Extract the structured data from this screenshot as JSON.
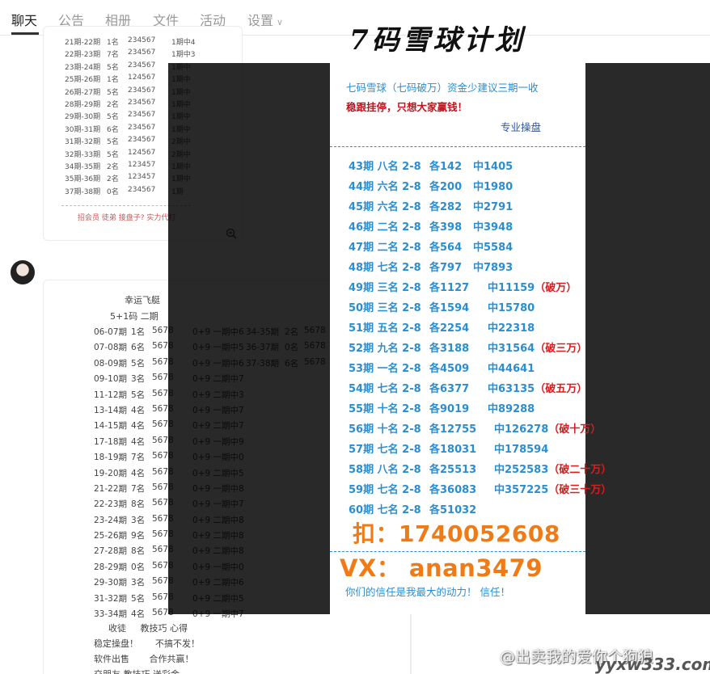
{
  "tabs": [
    "聊天",
    "公告",
    "相册",
    "文件",
    "活动",
    "设置"
  ],
  "card1": {
    "rows": [
      [
        "21期-22期",
        "1名",
        "234567",
        "1期中4"
      ],
      [
        "22期-23期",
        "7名",
        "234567",
        "1期中3"
      ],
      [
        "23期-24期",
        "5名",
        "234567",
        "1期中"
      ],
      [
        "25期-26期",
        "1名",
        "124567",
        "1期中"
      ],
      [
        "26期-27期",
        "5名",
        "234567",
        "1期中"
      ],
      [
        "28期-29期",
        "2名",
        "234567",
        "1期中"
      ],
      [
        "29期-30期",
        "5名",
        "234567",
        "1期中"
      ],
      [
        "30期-31期",
        "6名",
        "234567",
        "1期中"
      ],
      [
        "31期-32期",
        "5名",
        "234567",
        "2期中"
      ],
      [
        "32期-33期",
        "5名",
        "124567",
        "2期中"
      ],
      [
        "34期-35期",
        "2名",
        "123457",
        "1期中"
      ],
      [
        "35期-36期",
        "2名",
        "123457",
        "1期中"
      ],
      [
        "37期-38期",
        "0名",
        "234567",
        "1期"
      ]
    ],
    "footer": "招会员 徒弟 接盘子? 实力代打"
  },
  "card2": {
    "title": "幸运飞艇",
    "subtitle": "5+1码 二期",
    "rows": [
      [
        "06-07期",
        "1名",
        "5678",
        "0+9 一期中6"
      ],
      [
        "07-08期",
        "6名",
        "5678",
        "0+9 一期中5"
      ],
      [
        "08-09期",
        "5名",
        "5678",
        "0+9 一期中6"
      ],
      [
        "09-10期",
        "3名",
        "5678",
        "0+9 二期中7"
      ],
      [
        "11-12期",
        "5名",
        "5678",
        "0+9 二期中3"
      ],
      [
        "13-14期",
        "4名",
        "5678",
        "0+9 一期中7"
      ],
      [
        "14-15期",
        "4名",
        "5678",
        "0+9 二期中7"
      ],
      [
        "17-18期",
        "4名",
        "5678",
        "0+9 一期中9"
      ],
      [
        "18-19期",
        "7名",
        "5678",
        "0+9 一期中0"
      ],
      [
        "19-20期",
        "4名",
        "5678",
        "0+9 二期中5"
      ],
      [
        "21-22期",
        "7名",
        "5678",
        "0+9 一期中8"
      ],
      [
        "22-23期",
        "8名",
        "5678",
        "0+9 一期中7"
      ],
      [
        "23-24期",
        "3名",
        "5678",
        "0+9 二期中8"
      ],
      [
        "25-26期",
        "9名",
        "5678",
        "0+9 二期中8"
      ],
      [
        "27-28期",
        "8名",
        "5678",
        "0+9 二期中8"
      ],
      [
        "28-29期",
        "0名",
        "5678",
        "0+9 一期中0"
      ],
      [
        "29-30期",
        "3名",
        "5678",
        "0+9 二期中6"
      ],
      [
        "31-32期",
        "5名",
        "5678",
        "0+9 二期中5"
      ],
      [
        "33-34期",
        "4名",
        "5678",
        "0+9 一期中7"
      ]
    ],
    "right_rows": [
      [
        "34-35期",
        "2名",
        "5678"
      ],
      [
        "36-37期",
        "0名",
        "5678"
      ],
      [
        "37-38期",
        "6名",
        "5678"
      ]
    ],
    "footer_lines": [
      [
        "收徒",
        "教技巧 心得"
      ],
      [
        "稳定操盘！",
        "不搞不发！"
      ],
      [
        "软件出售",
        "合作共赢！"
      ],
      [
        "交朋友 教技巧 送彩金",
        ""
      ]
    ]
  },
  "poster": {
    "headline": "7码雪球计划",
    "line1": "七码雪球（七码破万）资金少建议三期一收",
    "line2": "稳跟挂停，只想大家赢钱！",
    "line3": "专业操盘",
    "rows": [
      {
        "period": "43期",
        "name": "八名 2-8",
        "bet": "各142",
        "win": "中1405",
        "note": ""
      },
      {
        "period": "44期",
        "name": "六名 2-8",
        "bet": "各200",
        "win": "中1980",
        "note": ""
      },
      {
        "period": "45期",
        "name": "六名 2-8",
        "bet": "各282",
        "win": "中2791",
        "note": ""
      },
      {
        "period": "46期",
        "name": "二名 2-8",
        "bet": "各398",
        "win": "中3948",
        "note": ""
      },
      {
        "period": "47期",
        "name": "二名 2-8",
        "bet": "各564",
        "win": "中5584",
        "note": ""
      },
      {
        "period": "48期",
        "name": "七名 2-8",
        "bet": "各797",
        "win": "中7893",
        "note": ""
      },
      {
        "period": "49期",
        "name": "三名 2-8",
        "bet": "各1127",
        "win": "中11159",
        "note": "（破万）"
      },
      {
        "period": "50期",
        "name": "三名 2-8",
        "bet": "各1594",
        "win": "中15780",
        "note": ""
      },
      {
        "period": "51期",
        "name": "五名 2-8",
        "bet": "各2254",
        "win": "中22318",
        "note": ""
      },
      {
        "period": "52期",
        "name": "九名 2-8",
        "bet": "各3188",
        "win": "中31564",
        "note": "（破三万）"
      },
      {
        "period": "53期",
        "name": "一名 2-8",
        "bet": "各4509",
        "win": "中44641",
        "note": ""
      },
      {
        "period": "54期",
        "name": "七名 2-8",
        "bet": "各6377",
        "win": "中63135",
        "note": "（破五万）"
      },
      {
        "period": "55期",
        "name": "十名 2-8",
        "bet": "各9019",
        "win": "中89288",
        "note": ""
      },
      {
        "period": "56期",
        "name": "十名 2-8",
        "bet": "各12755",
        "win": "中126278",
        "note": "（破十万）"
      },
      {
        "period": "57期",
        "name": "七名 2-8",
        "bet": "各18031",
        "win": "中178594",
        "note": ""
      },
      {
        "period": "58期",
        "name": "八名 2-8",
        "bet": "各25513",
        "win": "中252583",
        "note": "（破二十万）"
      },
      {
        "period": "59期",
        "name": "七名 2-8",
        "bet": "各36083",
        "win": "中357225",
        "note": "（破三十万）"
      },
      {
        "period": "60期",
        "name": "七名 2-8",
        "bet": "各51032",
        "win": "",
        "note": ""
      }
    ],
    "qq": "扣：1740052608",
    "vx": "VX： anan3479",
    "trust": "你们的信任是我最大的动力！ 信任！"
  },
  "watermark": {
    "text1": "@出卖我的爱你个狗狼",
    "text2": "yyxw333.com"
  },
  "colors": {
    "poster_blue": "#2a8ed1",
    "poster_red": "#c0141d",
    "contact_orange": "#f07b16",
    "overlay": "#000000"
  }
}
